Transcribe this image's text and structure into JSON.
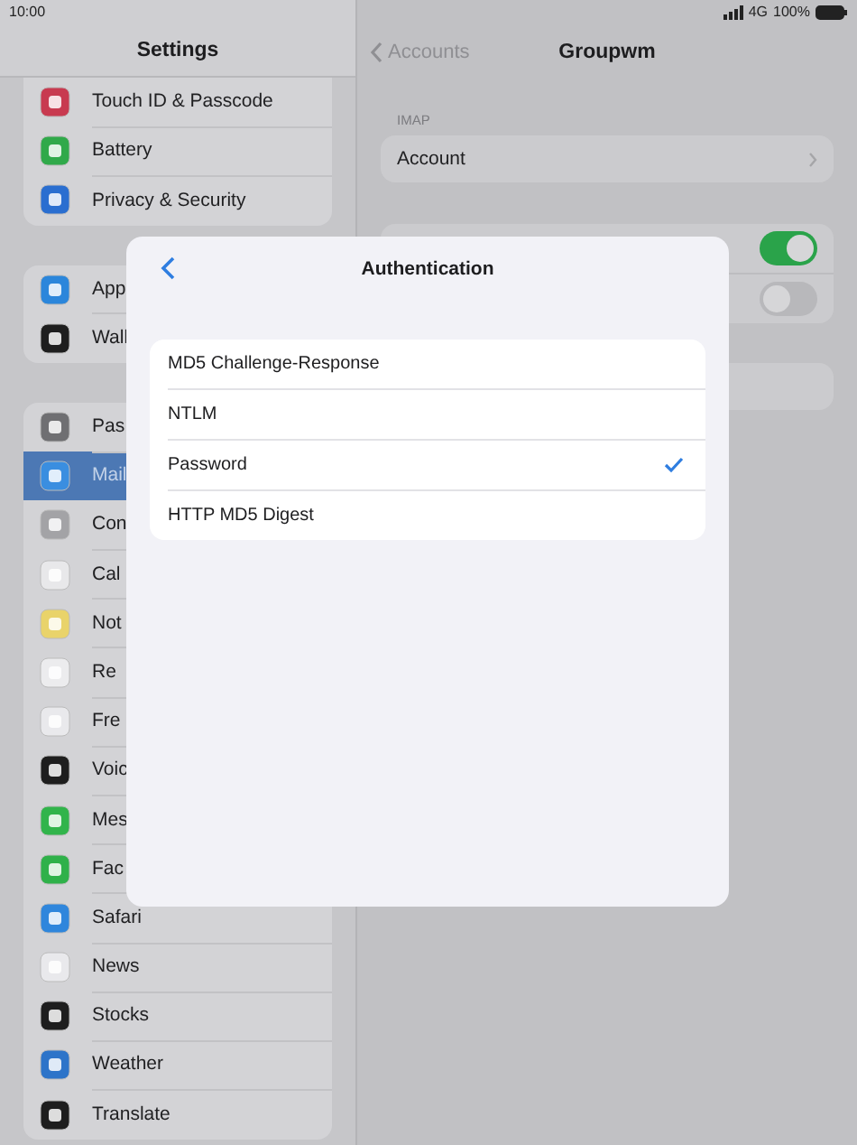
{
  "status_bar": {
    "time": "10:00",
    "network": "4G",
    "battery": "100%"
  },
  "sidebar": {
    "title": "Settings",
    "groups": [
      {
        "items": [
          {
            "label": "Touch ID & Passcode",
            "color": "#c83a50",
            "selected": false
          },
          {
            "label": "Battery",
            "color": "#30a94a",
            "selected": false
          },
          {
            "label": "Privacy & Security",
            "color": "#2a6ed0",
            "selected": false
          }
        ]
      },
      {
        "items": [
          {
            "label": "App",
            "color": "#2b86db",
            "selected": false
          },
          {
            "label": "Wall",
            "color": "#1e1e1e",
            "selected": false
          }
        ]
      },
      {
        "items": [
          {
            "label": "Pas",
            "color": "#6f6f72",
            "selected": false
          },
          {
            "label": "Mail",
            "color": "#3a8ee0",
            "selected": true
          },
          {
            "label": "Con",
            "color": "#a3a3a6",
            "selected": false
          },
          {
            "label": "Cal",
            "color": "#e8e8ea",
            "selected": false
          },
          {
            "label": "Not",
            "color": "#e9d36a",
            "selected": false
          },
          {
            "label": "Re",
            "color": "#ececee",
            "selected": false
          },
          {
            "label": "Fre",
            "color": "#e9e9ec",
            "selected": false
          },
          {
            "label": "Voic",
            "color": "#1e1e1e",
            "selected": false
          },
          {
            "label": "Mes",
            "color": "#31b44b",
            "selected": false
          },
          {
            "label": "Fac",
            "color": "#2fb14a",
            "selected": false
          },
          {
            "label": "Safari",
            "color": "#2f86dc",
            "selected": false
          },
          {
            "label": "News",
            "color": "#e9e9ec",
            "selected": false
          },
          {
            "label": "Stocks",
            "color": "#1e1e1e",
            "selected": false
          },
          {
            "label": "Weather",
            "color": "#2d74c9",
            "selected": false
          },
          {
            "label": "Translate",
            "color": "#1e1e1e",
            "selected": false
          }
        ]
      }
    ]
  },
  "detail": {
    "back": "Accounts",
    "title": "Groupwm",
    "section": "IMAP",
    "account": "Account",
    "toggles": [
      {
        "on": true
      },
      {
        "on": false
      }
    ]
  },
  "modal": {
    "title": "Authentication",
    "options": [
      {
        "label": "MD5 Challenge-Response",
        "selected": false
      },
      {
        "label": "NTLM",
        "selected": false
      },
      {
        "label": "Password",
        "selected": true
      },
      {
        "label": "HTTP MD5 Digest",
        "selected": false
      }
    ]
  }
}
